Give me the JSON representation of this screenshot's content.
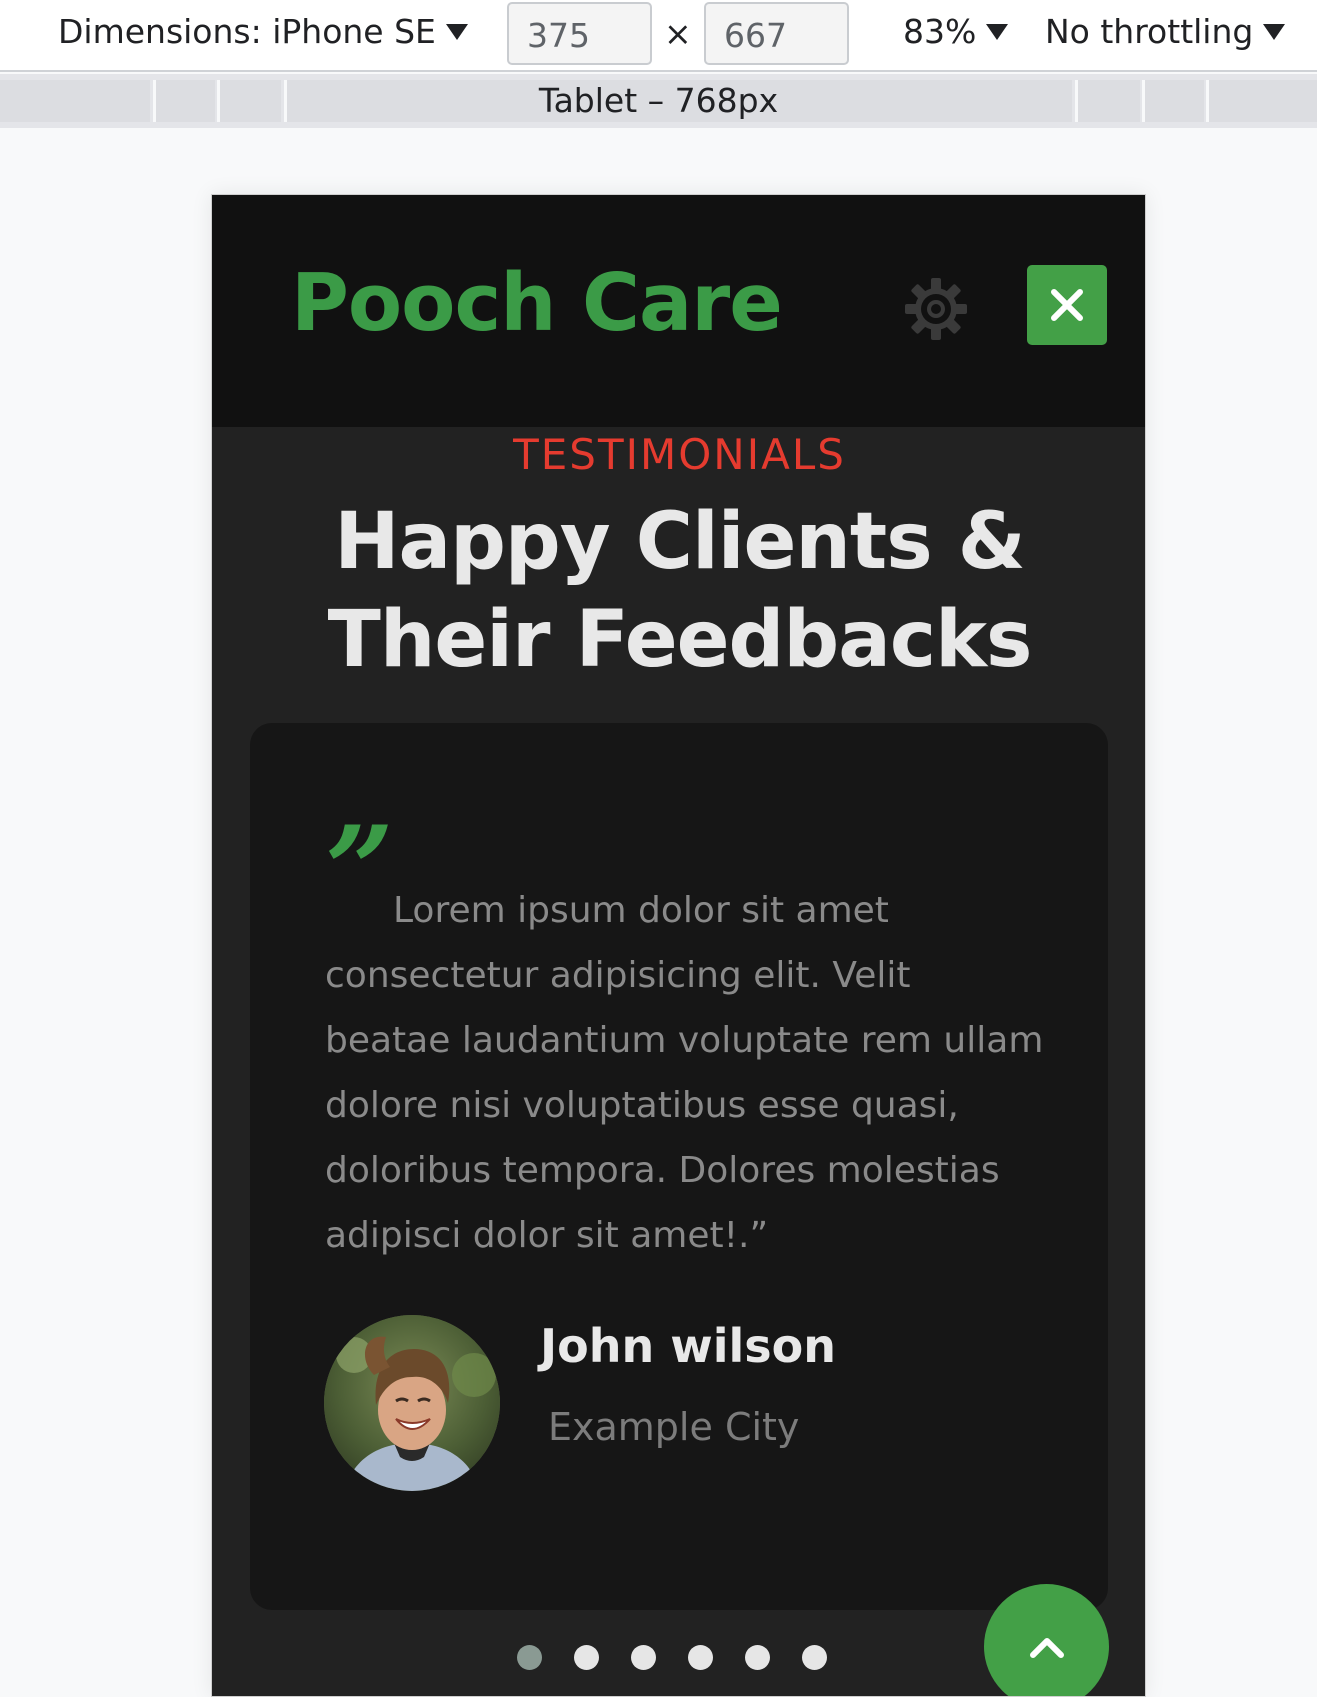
{
  "devtools": {
    "dimensions_label": "Dimensions: iPhone SE",
    "width_value": "375",
    "times_symbol": "×",
    "height_value": "667",
    "zoom": "83%",
    "throttling": "No throttling",
    "media_query_label": "Tablet – 768px"
  },
  "site": {
    "logo": "Pooch Care",
    "icons": {
      "settings": "gear-icon",
      "close": "close-icon",
      "scroll_top": "chevron-up-icon"
    },
    "colors": {
      "brand_green": "#3b9b47",
      "button_green": "#43a047",
      "eyebrow_red": "#e53b2f",
      "page_bg": "#222222",
      "card_bg": "#161616"
    }
  },
  "testimonials": {
    "eyebrow": "TESTIMONIALS",
    "heading_line1": "Happy Clients &",
    "heading_line2": "Their Feedbacks",
    "quote_mark": "”",
    "quote": "Lorem ipsum dolor sit amet consectetur adipisicing elit. Velit beatae laudantium voluptate rem ullam dolore nisi voluptatibus esse quasi, doloribus tempora. Dolores molestias adipisci dolor sit amet!.”",
    "client_name": "John wilson",
    "client_city": "Example City",
    "pagination": {
      "total": 6,
      "active_index": 0
    }
  }
}
